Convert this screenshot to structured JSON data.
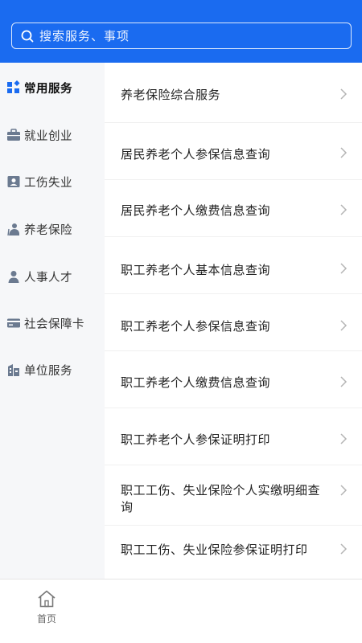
{
  "search": {
    "placeholder": "搜索服务、事项"
  },
  "sidebar": {
    "items": [
      {
        "label": "常用服务",
        "icon": "grid-icon",
        "active": true
      },
      {
        "label": "就业创业",
        "icon": "briefcase-icon"
      },
      {
        "label": "工伤失业",
        "icon": "id-card-icon"
      },
      {
        "label": "养老保险",
        "icon": "elder-icon"
      },
      {
        "label": "人事人才",
        "icon": "person-icon"
      },
      {
        "label": "社会保障卡",
        "icon": "card-icon"
      },
      {
        "label": "单位服务",
        "icon": "building-icon"
      }
    ]
  },
  "services": [
    {
      "label": "养老保险综合服务"
    },
    {
      "label": "居民养老个人参保信息查询"
    },
    {
      "label": "居民养老个人缴费信息查询"
    },
    {
      "label": "职工养老个人基本信息查询"
    },
    {
      "label": "职工养老个人参保信息查询"
    },
    {
      "label": "职工养老个人缴费信息查询"
    },
    {
      "label": "职工养老个人参保证明打印"
    },
    {
      "label": "职工工伤、失业保险个人实缴明细查询"
    },
    {
      "label": "职工工伤、失业保险参保证明打印"
    }
  ],
  "tabbar": {
    "home_label": "首页"
  },
  "colors": {
    "primary": "#1a6bf0",
    "sidebar_icon": "#6b7a90",
    "active_icon": "#1a6bf0"
  }
}
